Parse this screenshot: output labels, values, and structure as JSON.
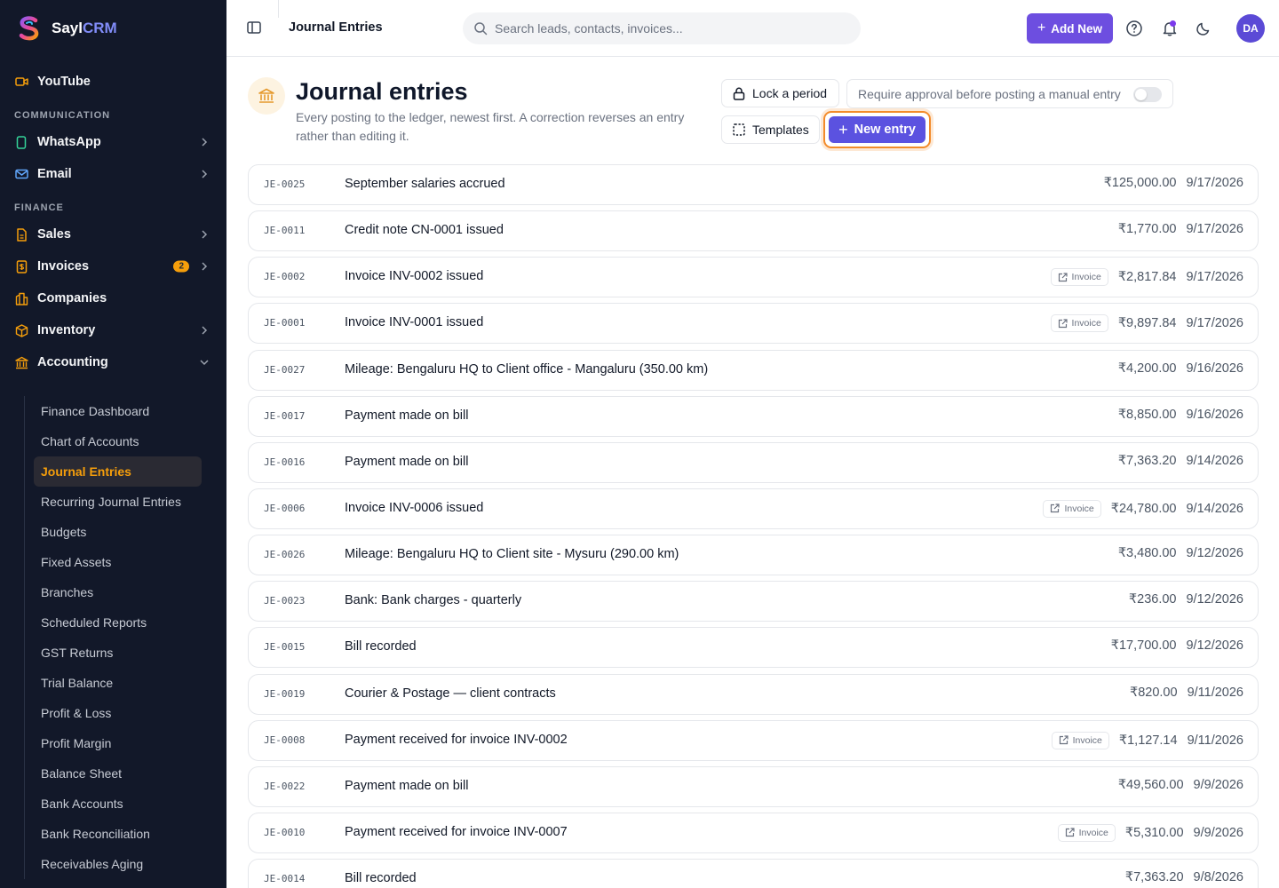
{
  "brand": {
    "name_prefix": "Sayl",
    "name_suffix": "CRM"
  },
  "sidebar": {
    "top_items": [
      {
        "label": "YouTube",
        "icon": "video-icon"
      }
    ],
    "sections": [
      {
        "label": "COMMUNICATION",
        "items": [
          {
            "label": "WhatsApp",
            "icon": "phone-icon"
          },
          {
            "label": "Email",
            "icon": "mail-icon"
          }
        ]
      },
      {
        "label": "FINANCE",
        "items": [
          {
            "label": "Sales",
            "icon": "file-icon"
          },
          {
            "label": "Invoices",
            "icon": "receipt-icon",
            "badge": "2"
          },
          {
            "label": "Companies",
            "icon": "building-icon"
          },
          {
            "label": "Inventory",
            "icon": "box-icon"
          },
          {
            "label": "Accounting",
            "icon": "bank-icon"
          }
        ]
      }
    ],
    "accounting_subitems": [
      "Finance Dashboard",
      "Chart of Accounts",
      "Journal Entries",
      "Recurring Journal Entries",
      "Budgets",
      "Fixed Assets",
      "Branches",
      "Scheduled Reports",
      "GST Returns",
      "Trial Balance",
      "Profit & Loss",
      "Profit Margin",
      "Balance Sheet",
      "Bank Accounts",
      "Bank Reconciliation",
      "Receivables Aging"
    ],
    "active_subitem": "Journal Entries"
  },
  "topbar": {
    "page_title": "Journal Entries",
    "search_placeholder": "Search leads, contacts, invoices...",
    "add_new_label": "Add New",
    "avatar_initials": "DA"
  },
  "header": {
    "title": "Journal entries",
    "subtitle": "Every posting to the ledger, newest first. A correction reverses an entry rather than editing it.",
    "lock_label": "Lock a period",
    "approval_label": "Require approval before posting a manual entry",
    "approval_enabled": false,
    "templates_label": "Templates",
    "new_entry_label": "New entry"
  },
  "entries": [
    {
      "code": "JE-0025",
      "description": "September salaries accrued",
      "tag": "",
      "amount": "₹125,000.00",
      "date": "9/17/2026"
    },
    {
      "code": "JE-0011",
      "description": "Credit note CN-0001 issued",
      "tag": "",
      "amount": "₹1,770.00",
      "date": "9/17/2026"
    },
    {
      "code": "JE-0002",
      "description": "Invoice INV-0002 issued",
      "tag": "Invoice",
      "amount": "₹2,817.84",
      "date": "9/17/2026"
    },
    {
      "code": "JE-0001",
      "description": "Invoice INV-0001 issued",
      "tag": "Invoice",
      "amount": "₹9,897.84",
      "date": "9/17/2026"
    },
    {
      "code": "JE-0027",
      "description": "Mileage: Bengaluru HQ to Client office - Mangaluru (350.00 km)",
      "tag": "",
      "amount": "₹4,200.00",
      "date": "9/16/2026"
    },
    {
      "code": "JE-0017",
      "description": "Payment made on bill",
      "tag": "",
      "amount": "₹8,850.00",
      "date": "9/16/2026"
    },
    {
      "code": "JE-0016",
      "description": "Payment made on bill",
      "tag": "",
      "amount": "₹7,363.20",
      "date": "9/14/2026"
    },
    {
      "code": "JE-0006",
      "description": "Invoice INV-0006 issued",
      "tag": "Invoice",
      "amount": "₹24,780.00",
      "date": "9/14/2026"
    },
    {
      "code": "JE-0026",
      "description": "Mileage: Bengaluru HQ to Client site - Mysuru (290.00 km)",
      "tag": "",
      "amount": "₹3,480.00",
      "date": "9/12/2026"
    },
    {
      "code": "JE-0023",
      "description": "Bank: Bank charges - quarterly",
      "tag": "",
      "amount": "₹236.00",
      "date": "9/12/2026"
    },
    {
      "code": "JE-0015",
      "description": "Bill recorded",
      "tag": "",
      "amount": "₹17,700.00",
      "date": "9/12/2026"
    },
    {
      "code": "JE-0019",
      "description": "Courier & Postage — client contracts",
      "tag": "",
      "amount": "₹820.00",
      "date": "9/11/2026"
    },
    {
      "code": "JE-0008",
      "description": "Payment received for invoice INV-0002",
      "tag": "Invoice",
      "amount": "₹1,127.14",
      "date": "9/11/2026"
    },
    {
      "code": "JE-0022",
      "description": "Payment made on bill",
      "tag": "",
      "amount": "₹49,560.00",
      "date": "9/9/2026"
    },
    {
      "code": "JE-0010",
      "description": "Payment received for invoice INV-0007",
      "tag": "Invoice",
      "amount": "₹5,310.00",
      "date": "9/9/2026"
    },
    {
      "code": "JE-0014",
      "description": "Bill recorded",
      "tag": "",
      "amount": "₹7,363.20",
      "date": "9/8/2026"
    }
  ],
  "colors": {
    "sidebar_bg": "#121829",
    "accent_orange": "#f59e0b",
    "primary_purple": "#6d4ee0",
    "new_entry_bg": "#5b52e0",
    "focus_ring": "#f38b2a"
  }
}
